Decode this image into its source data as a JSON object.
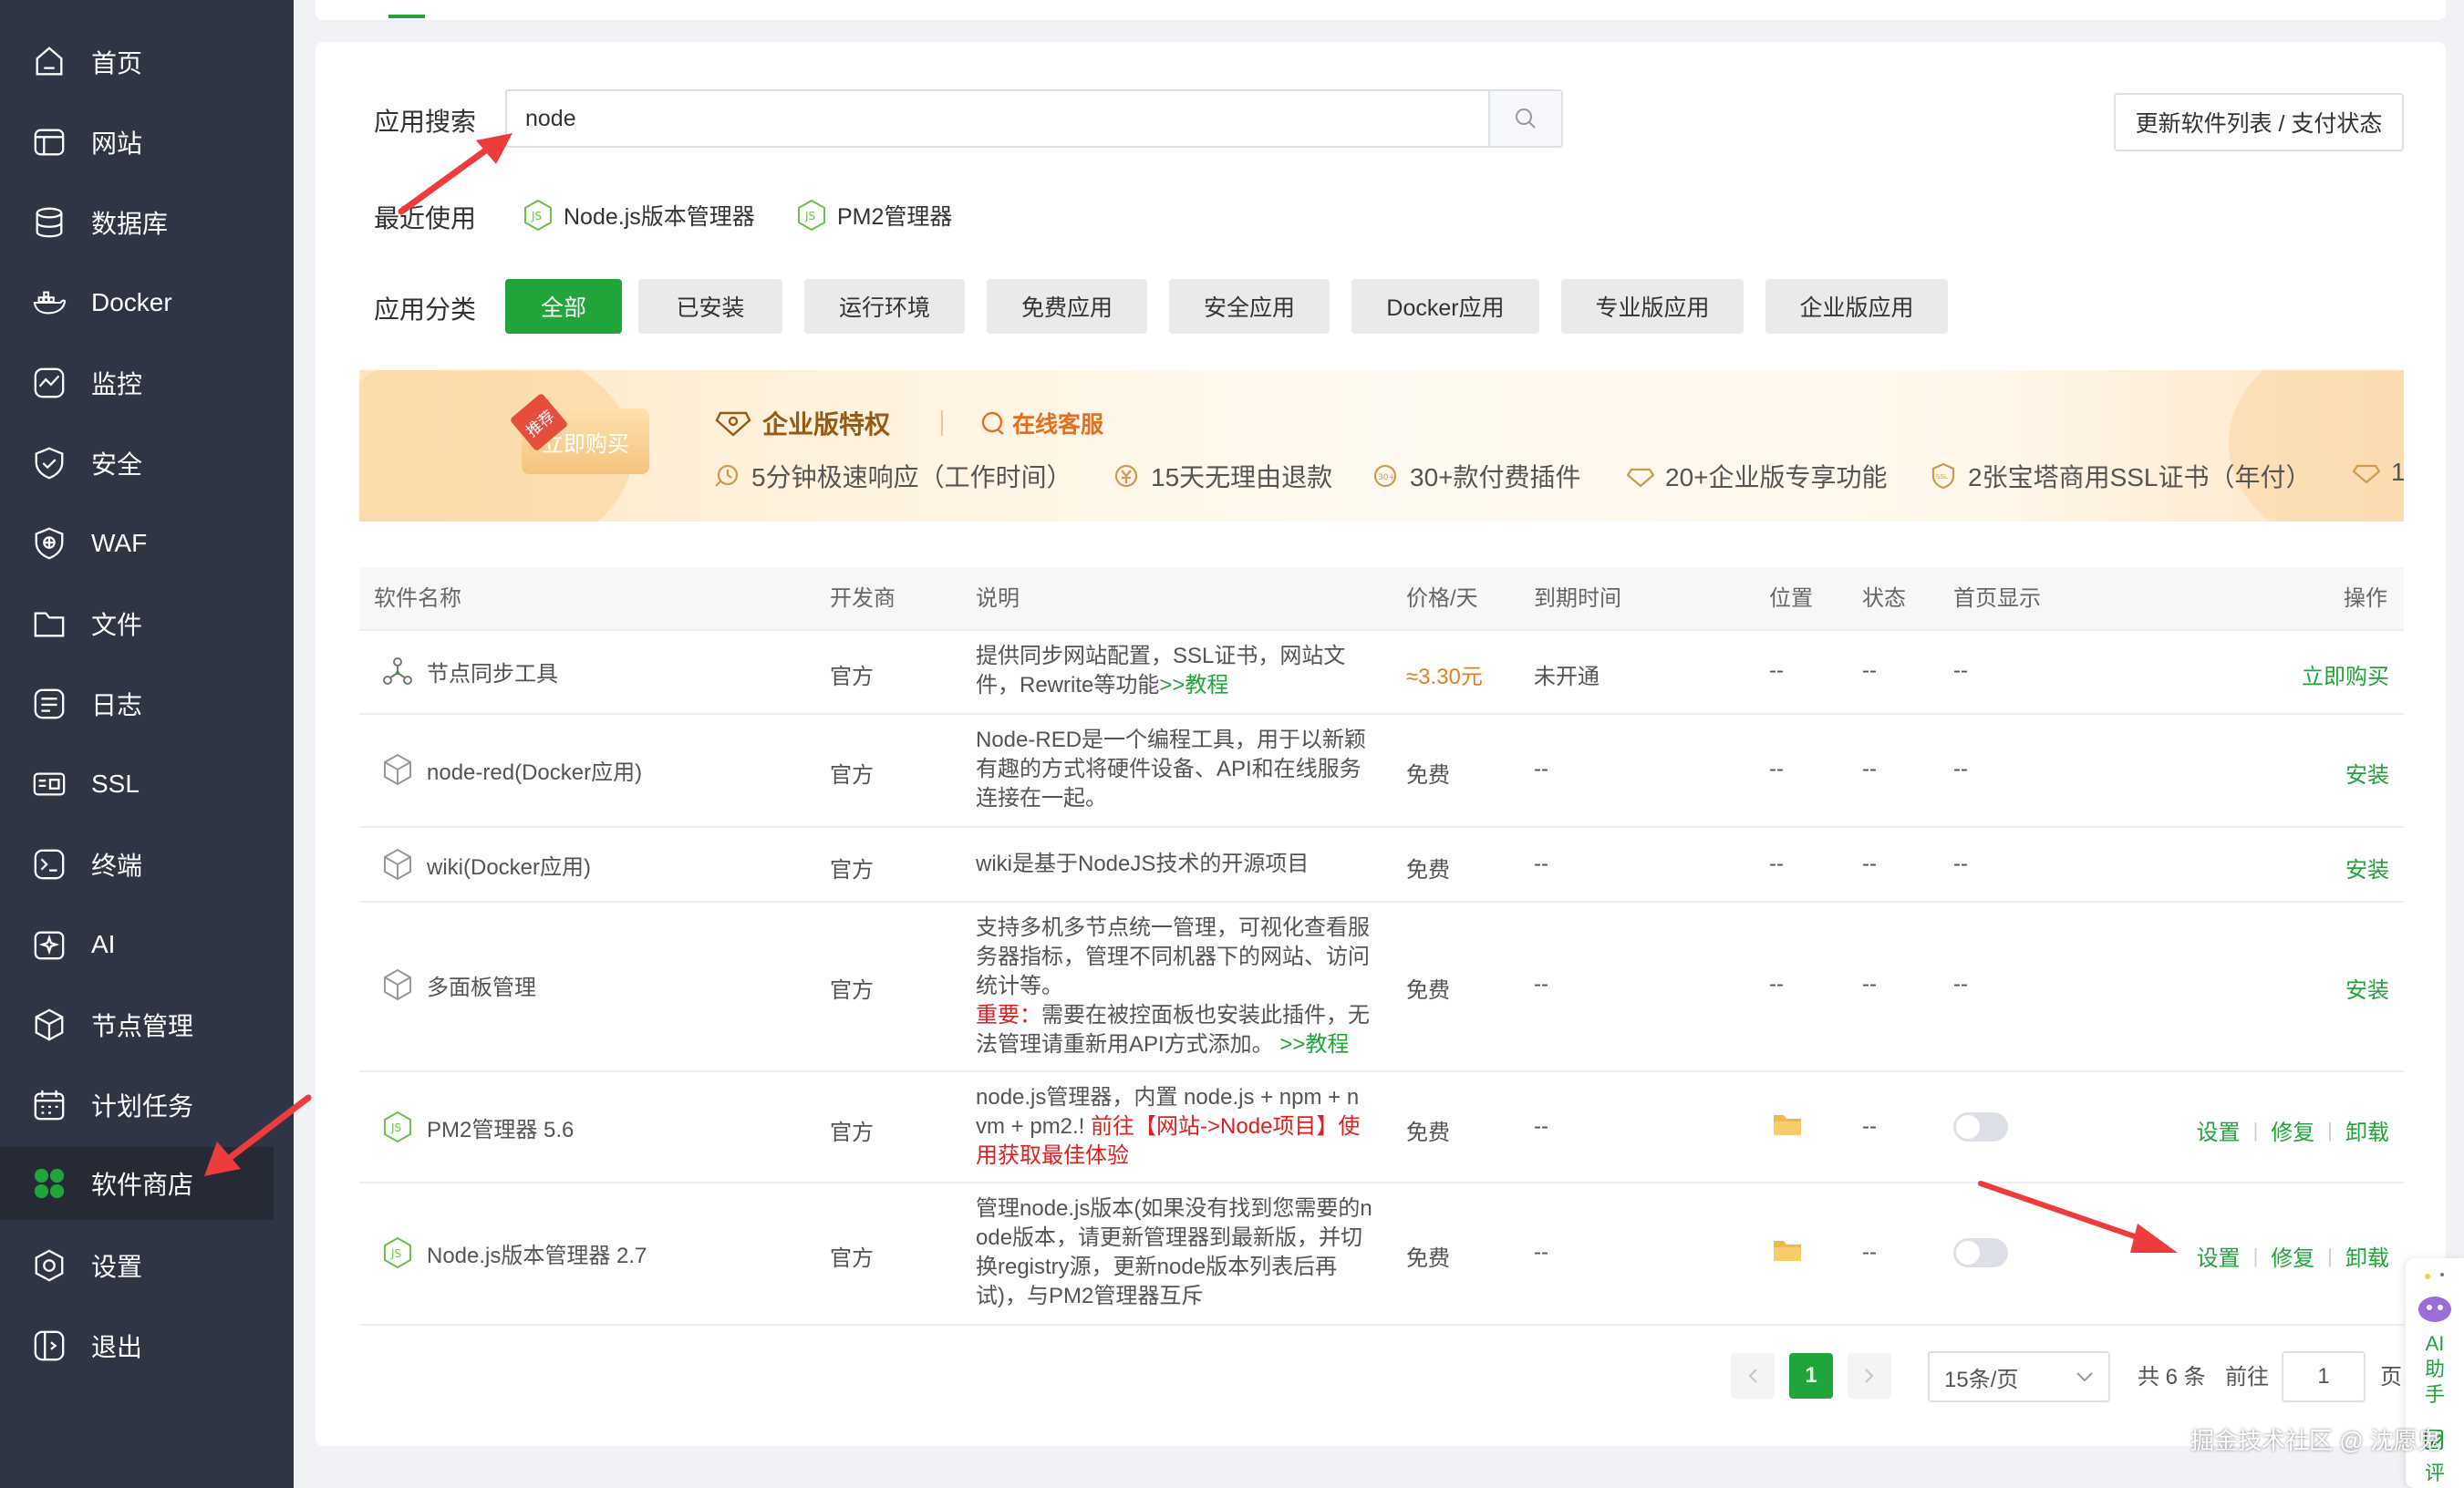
{
  "sidebar": {
    "items": [
      {
        "label": "首页",
        "icon": "home-icon"
      },
      {
        "label": "网站",
        "icon": "website-icon"
      },
      {
        "label": "数据库",
        "icon": "database-icon"
      },
      {
        "label": "Docker",
        "icon": "docker-icon"
      },
      {
        "label": "监控",
        "icon": "monitor-icon"
      },
      {
        "label": "安全",
        "icon": "shield-icon"
      },
      {
        "label": "WAF",
        "icon": "waf-icon"
      },
      {
        "label": "文件",
        "icon": "folder-icon"
      },
      {
        "label": "日志",
        "icon": "log-icon"
      },
      {
        "label": "SSL",
        "icon": "ssl-icon"
      },
      {
        "label": "终端",
        "icon": "terminal-icon"
      },
      {
        "label": "AI",
        "icon": "ai-icon"
      },
      {
        "label": "节点管理",
        "icon": "node-icon"
      },
      {
        "label": "计划任务",
        "icon": "calendar-icon"
      },
      {
        "label": "软件商店",
        "icon": "store-icon"
      },
      {
        "label": "设置",
        "icon": "settings-icon"
      },
      {
        "label": "退出",
        "icon": "logout-icon"
      }
    ],
    "active_index": 14
  },
  "search": {
    "label": "应用搜索",
    "value": "node"
  },
  "update_button": "更新软件列表 / 支付状态",
  "recent": {
    "label": "最近使用",
    "items": [
      "Node.js版本管理器",
      "PM2管理器"
    ]
  },
  "categories": {
    "label": "应用分类",
    "items": [
      "全部",
      "已安装",
      "运行环境",
      "免费应用",
      "安全应用",
      "Docker应用",
      "专业版应用",
      "企业版应用"
    ],
    "active_index": 0
  },
  "banner": {
    "tag": "推荐",
    "buy_label": "立即购买",
    "title": "企业版特权",
    "service": "在线客服",
    "features": [
      "5分钟极速响应（工作时间）",
      "15天无理由退款",
      "30+款付费插件",
      "20+企业版专享功能",
      "2张宝塔商用SSL证书（年付）",
      "1"
    ]
  },
  "table": {
    "headers": {
      "name": "软件名称",
      "vendor": "开发商",
      "desc": "说明",
      "price": "价格/天",
      "expire": "到期时间",
      "location": "位置",
      "status": "状态",
      "home": "首页显示",
      "ops": "操作"
    },
    "rows": [
      {
        "name": "节点同步工具",
        "vendor": "官方",
        "desc_lines": [
          "提供同步网站配置，SSL证书，网站文",
          "件，Rewrite等功能"
        ],
        "desc_link": ">>教程",
        "price": "≈3.30元",
        "expire": "未开通",
        "location": "--",
        "status": "--",
        "home": "--",
        "ops": [
          "立即购买"
        ]
      },
      {
        "name": "node-red(Docker应用)",
        "vendor": "官方",
        "desc_lines": [
          "Node-RED是一个编程工具，用于以新颖",
          "有趣的方式将硬件设备、API和在线服务",
          "连接在一起。"
        ],
        "price": "免费",
        "expire": "--",
        "location": "--",
        "status": "--",
        "home": "--",
        "ops": [
          "安装"
        ]
      },
      {
        "name": "wiki(Docker应用)",
        "vendor": "官方",
        "desc_lines": [
          "wiki是基于NodeJS技术的开源项目"
        ],
        "price": "免费",
        "expire": "--",
        "location": "--",
        "status": "--",
        "home": "--",
        "ops": [
          "安装"
        ]
      },
      {
        "name": "多面板管理",
        "vendor": "官方",
        "desc_lines": [
          "支持多机多节点统一管理，可视化查看服",
          "务器指标，管理不同机器下的网站、访问",
          "统计等。"
        ],
        "desc_important_label": "重要：",
        "desc_important_lines": [
          "需要在被控面板也安装此插件，无",
          "法管理请重新用API方式添加。"
        ],
        "desc_link": ">>教程",
        "price": "免费",
        "expire": "--",
        "location": "--",
        "status": "--",
        "home": "--",
        "ops": [
          "安装"
        ]
      },
      {
        "name": "PM2管理器 5.6",
        "vendor": "官方",
        "desc_lines": [
          "node.js管理器，内置 node.js + npm + n",
          "vm + pm2.!"
        ],
        "desc_red": "前往【网站->Node项目】使",
        "desc_red_2": "用获取最佳体验",
        "price": "免费",
        "expire": "--",
        "status": "--",
        "ops": [
          "设置",
          "修复",
          "卸载"
        ]
      },
      {
        "name": "Node.js版本管理器 2.7",
        "vendor": "官方",
        "desc_lines": [
          "管理node.js版本(如果没有找到您需要的n",
          "ode版本，请更新管理器到最新版，并切",
          "换registry源，更新node版本列表后再",
          "试)，与PM2管理器互斥"
        ],
        "price": "免费",
        "expire": "--",
        "status": "--",
        "ops": [
          "设置",
          "修复",
          "卸载"
        ]
      }
    ]
  },
  "pagination": {
    "current": "1",
    "page_size": "15条/页",
    "total": "共 6 条",
    "goto_label": "前往",
    "goto_value": "1",
    "page_suffix": "页"
  },
  "watermark": "掘金技术社区 @ 沈愿鬼",
  "ai_assistant": {
    "label": "AI助手",
    "review": "评"
  },
  "colors": {
    "accent": "#20a53a",
    "sidebar_bg": "#2f3544",
    "price": "#e67e22",
    "warning": "#e02020",
    "arrow": "#ee3b3b"
  }
}
